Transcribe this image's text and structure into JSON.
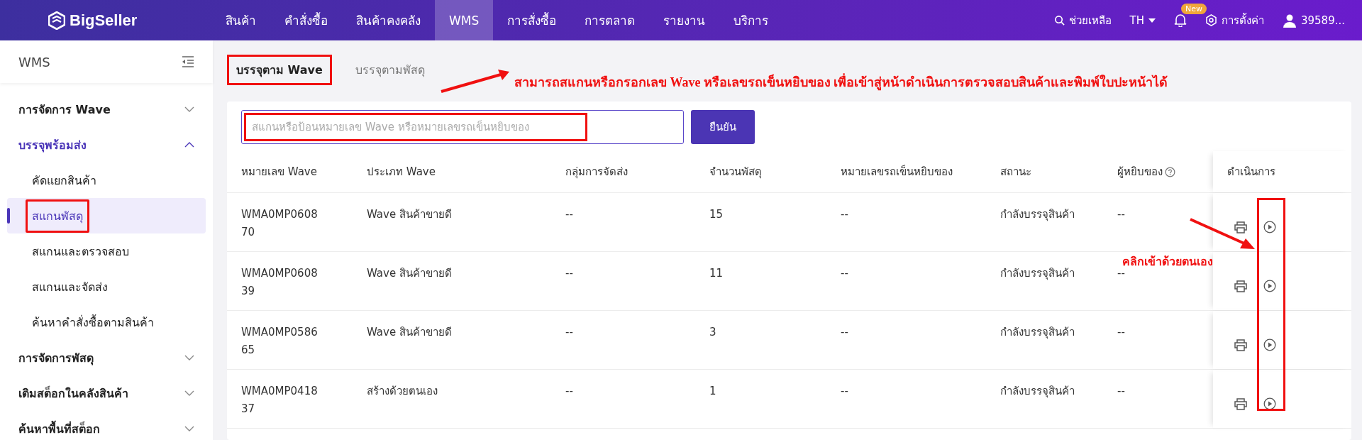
{
  "topbar": {
    "logo": "BigSeller",
    "nav": [
      {
        "label": "สินค้า",
        "selected": false
      },
      {
        "label": "คำสั่งซื้อ",
        "selected": false
      },
      {
        "label": "สินค้าคงคลัง",
        "selected": false
      },
      {
        "label": "WMS",
        "selected": true
      },
      {
        "label": "การสั่งซื้อ",
        "selected": false
      },
      {
        "label": "การตลาด",
        "selected": false
      },
      {
        "label": "รายงาน",
        "selected": false
      },
      {
        "label": "บริการ",
        "selected": false
      }
    ],
    "help": "ช่วยเหลือ",
    "language": "TH",
    "badge": "New",
    "settings": "การตั้งค่า",
    "user": "39589..."
  },
  "sidebar": {
    "title": "WMS",
    "items": [
      {
        "label": "การจัดการ Wave",
        "expanded": false
      },
      {
        "label": "บรรจุพร้อมส่ง",
        "expanded": true,
        "children": [
          {
            "label": "คัดแยกสินค้า",
            "selected": false,
            "highlighted": false
          },
          {
            "label": "สแกนพัสดุ",
            "selected": true,
            "highlighted": true
          },
          {
            "label": "สแกนและตรวจสอบ",
            "selected": false,
            "highlighted": false
          },
          {
            "label": "สแกนและจัดส่ง",
            "selected": false,
            "highlighted": false
          },
          {
            "label": "ค้นหาคำสั่งซื้อตามสินค้า",
            "selected": false,
            "highlighted": false
          }
        ]
      },
      {
        "label": "การจัดการพัสดุ",
        "expanded": false
      },
      {
        "label": "เติมสต็อกในคลังสินค้า",
        "expanded": false
      },
      {
        "label": "ค้นหาพื้นที่สต็อก",
        "expanded": false
      }
    ]
  },
  "tabs": [
    {
      "label": "บรรจุตาม Wave",
      "selected": true,
      "highlighted": true
    },
    {
      "label": "บรรจุตามพัสดุ",
      "selected": false,
      "highlighted": false
    }
  ],
  "search": {
    "placeholder": "สแกนหรือป้อนหมายเลข Wave หรือหมายเลขรถเข็นหยิบของ",
    "highlighted": true
  },
  "confirm_button": "ยืนยัน",
  "table": {
    "columns": [
      "หมายเลข Wave",
      "ประเภท Wave",
      "กลุ่มการจัดส่ง",
      "จำนวนพัสดุ",
      "หมายเลขรถเข็นหยิบของ",
      "สถานะ",
      "ผู้หยิบของ",
      "ดำเนินการ"
    ],
    "rows": [
      [
        "WMA0MP060870",
        "Wave สินค้าขายดี",
        "--",
        "15",
        "--",
        "กำลังบรรจุสินค้า",
        "--"
      ],
      [
        "WMA0MP060839",
        "Wave สินค้าขายดี",
        "--",
        "11",
        "--",
        "กำลังบรรจุสินค้า",
        "--"
      ],
      [
        "WMA0MP058665",
        "Wave สินค้าขายดี",
        "--",
        "3",
        "--",
        "กำลังบรรจุสินค้า",
        "--"
      ],
      [
        "WMA0MP041837",
        "สร้างด้วยตนเอง",
        "--",
        "1",
        "--",
        "กำลังบรรจุสินค้า",
        "--"
      ]
    ],
    "start_buttons_highlighted": true
  },
  "annotations": [
    "สามารถสแกนหรือกรอกเลข Wave หรือเลขรถเข็นหยิบของ เพื่อเข้าสู่หน้าดำเนินการตรวจสอบสินค้าและพิมพ์ใบปะหน้าได้",
    "คลิกเข้าด้วยตนเอง"
  ]
}
